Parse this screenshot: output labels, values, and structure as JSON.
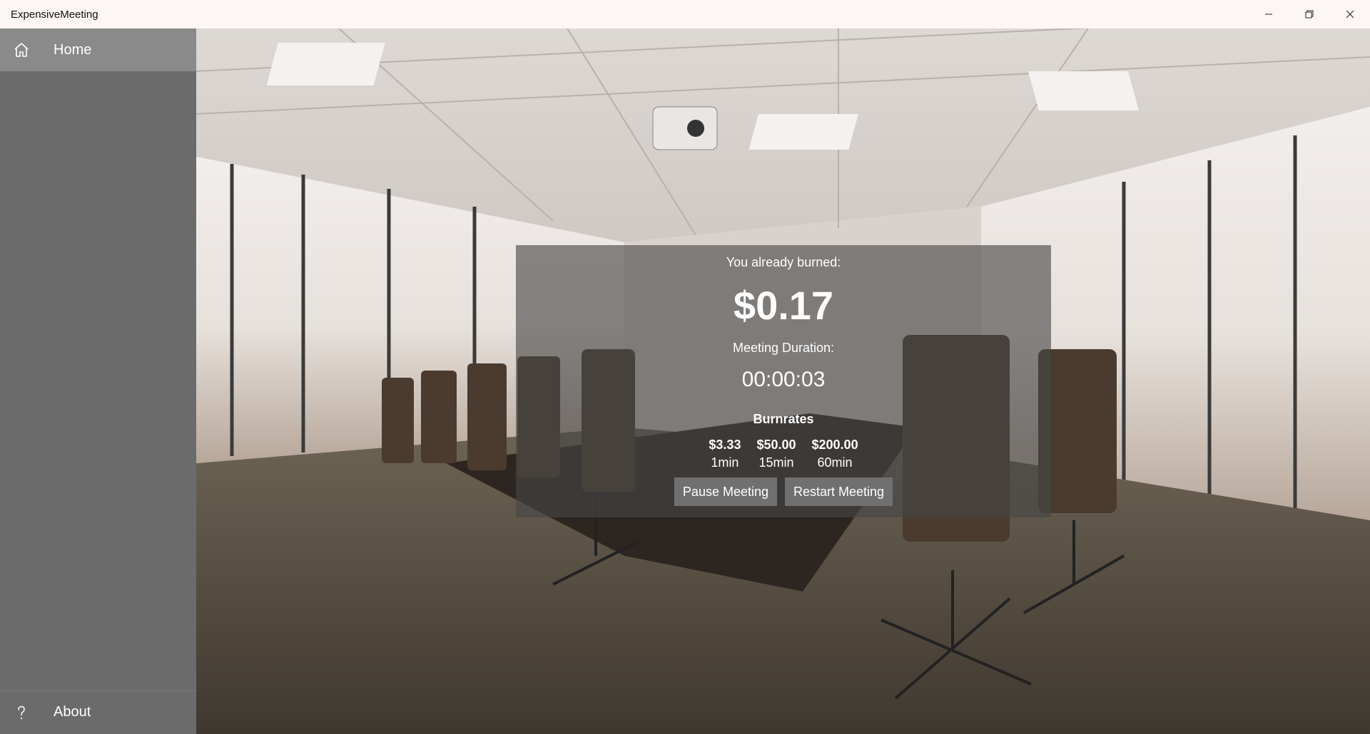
{
  "app": {
    "title": "ExpensiveMeeting"
  },
  "sidebar": {
    "items": [
      {
        "label": "Home",
        "icon": "home-icon",
        "selected": true
      },
      {
        "label": "About",
        "icon": "help-icon",
        "selected": false
      }
    ]
  },
  "meeting": {
    "burned_label": "You already burned:",
    "burned_amount": "$0.17",
    "duration_label": "Meeting Duration:",
    "duration_value": "00:00:03",
    "burnrates_heading": "Burnrates",
    "burnrates": [
      {
        "amount": "$3.33",
        "period": "1min"
      },
      {
        "amount": "$50.00",
        "period": "15min"
      },
      {
        "amount": "$200.00",
        "period": "60min"
      }
    ],
    "pause_button": "Pause Meeting",
    "restart_button": "Restart Meeting"
  },
  "colors": {
    "sidebar": "#6b6b6b",
    "sidebar_selected": "#8a8a8a",
    "titlebar": "#fcf6f5",
    "card_overlay": "#464646",
    "button": "#707070"
  }
}
